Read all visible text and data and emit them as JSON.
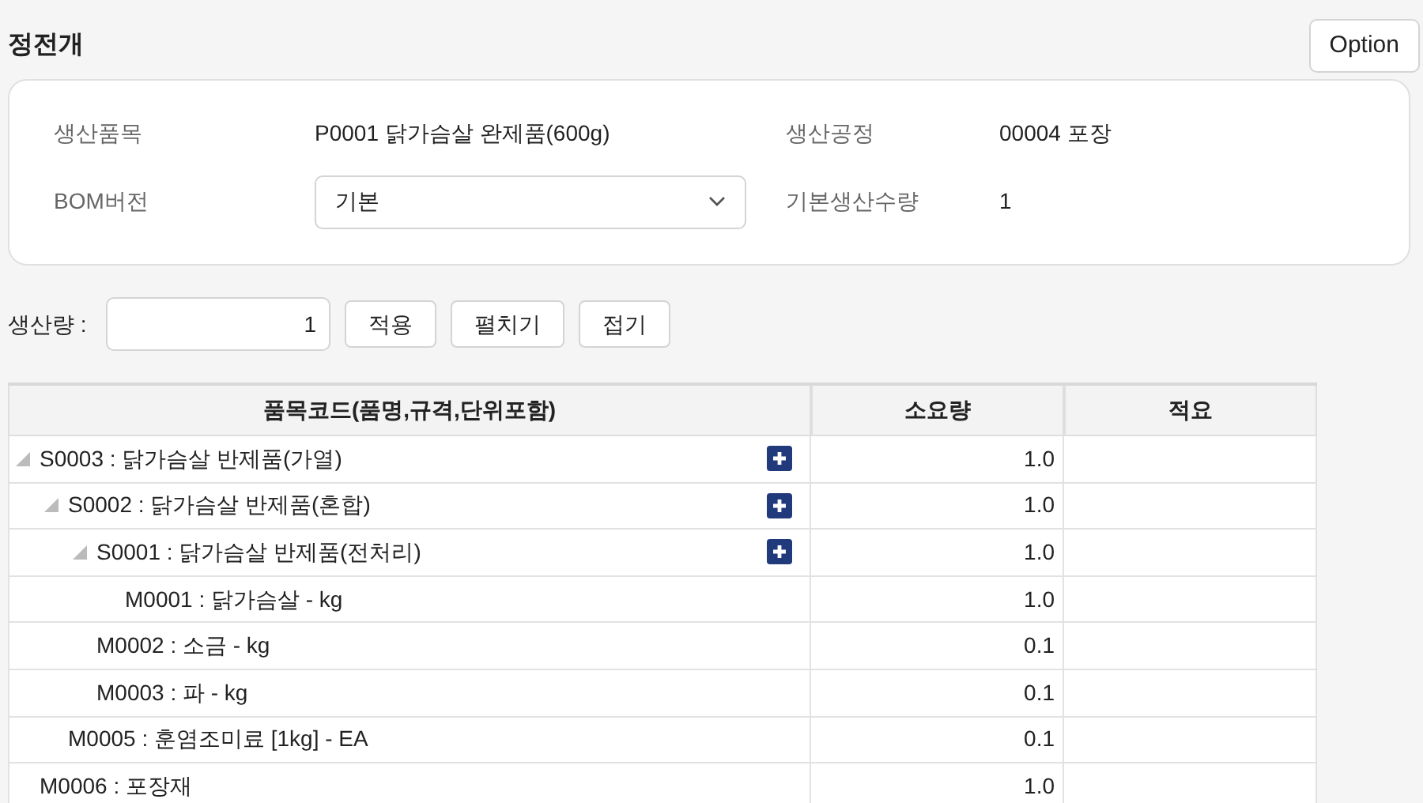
{
  "title": "정전개",
  "option_button": "Option",
  "info": {
    "fields": [
      {
        "label": "생산품목",
        "value": "P0001 닭가슴살 완제품(600g)",
        "kind": "text"
      },
      {
        "label": "생산공정",
        "value": "00004 포장",
        "kind": "text"
      },
      {
        "label": "BOM버전",
        "value": "기본",
        "kind": "select"
      },
      {
        "label": "기본생산수량",
        "value": "1",
        "kind": "text"
      }
    ]
  },
  "toolbar": {
    "quantity_label": "생산량 :",
    "quantity_value": "1",
    "buttons": [
      "적용",
      "펼치기",
      "접기"
    ]
  },
  "table": {
    "columns": [
      "품목코드(품명,규격,단위포함)",
      "소요량",
      "적요"
    ],
    "rows": [
      {
        "item": "S0003 : 닭가슴살 반제품(가열)",
        "quantity": "1.0",
        "expanded": true,
        "children": [
          {
            "item": "S0002 : 닭가슴살 반제품(혼합)",
            "quantity": "1.0",
            "expanded": true,
            "children": [
              {
                "item": "S0001 : 닭가슴살 반제품(전처리)",
                "quantity": "1.0",
                "expanded": true,
                "children": [
                  {
                    "item": "M0001 : 닭가슴살 - kg",
                    "quantity": "1.0"
                  }
                ]
              },
              {
                "item": "M0002 : 소금 - kg",
                "quantity": "0.1"
              },
              {
                "item": "M0003 : 파 - kg",
                "quantity": "0.1"
              }
            ]
          },
          {
            "item": "M0005 : 훈염조미료 [1kg] - EA",
            "quantity": "0.1"
          }
        ]
      },
      {
        "item": "M0006 : 포장재",
        "quantity": "1.0"
      }
    ]
  }
}
